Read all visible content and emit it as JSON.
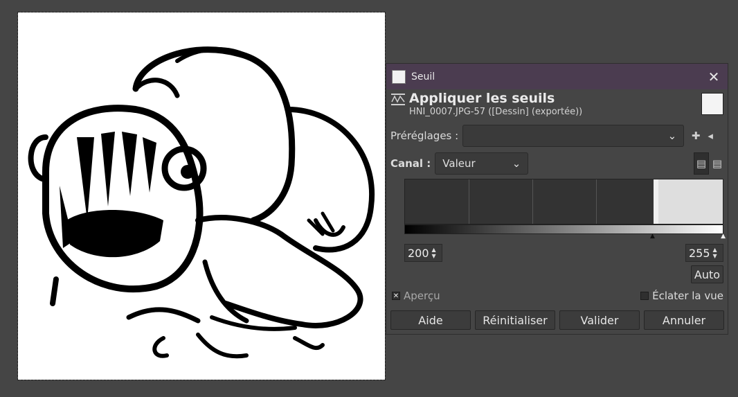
{
  "dialog": {
    "window_title": "Seuil",
    "header_title": "Appliquer les seuils",
    "header_subtitle": "HNI_0007.JPG-57 ([Dessin] (exportée))",
    "presets_label": "Préréglages :",
    "presets_value": "",
    "channel_label": "Canal :",
    "channel_value": "Valeur",
    "low_threshold": "200",
    "high_threshold": "255",
    "auto_label": "Auto",
    "preview_label": "Aperçu",
    "preview_checked": true,
    "split_view_label": "Éclater la vue",
    "split_view_checked": false,
    "buttons": {
      "help": "Aide",
      "reset": "Réinitialiser",
      "ok": "Valider",
      "cancel": "Annuler"
    },
    "icons": {
      "close": "close-icon",
      "add_preset": "plus-icon",
      "manage_presets": "presets-menu-icon",
      "linear_histogram": "linear-histogram-icon",
      "log_histogram": "log-histogram-icon"
    }
  },
  "colors": {
    "titlebar": "#4b3c50",
    "background": "#454545"
  }
}
